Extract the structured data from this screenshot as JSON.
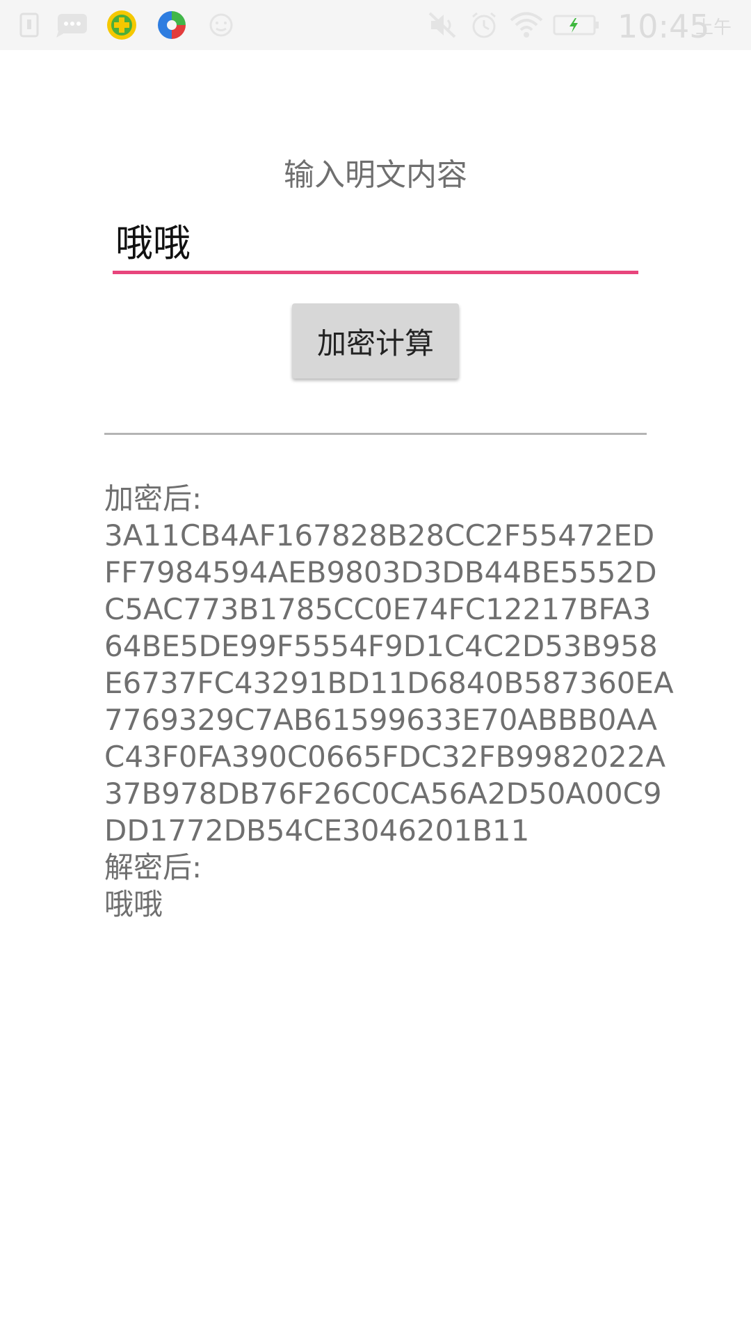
{
  "status_bar": {
    "time": "10:45",
    "ampm": "上午",
    "left_icons": [
      "sim-card-icon",
      "message-icon",
      "security-app-icon",
      "browser-app-icon",
      "face-icon"
    ],
    "right_icons": [
      "mute-icon",
      "alarm-icon",
      "wifi-icon",
      "battery-charging-icon"
    ],
    "colors": {
      "charging": "#3fb83f",
      "security_app": "#f5c800",
      "browser_blue": "#2e7de0",
      "browser_red": "#e23c3c",
      "browser_green": "#41b649"
    }
  },
  "form": {
    "prompt": "输入明文内容",
    "input_value": "哦哦",
    "button_label": "加密计算",
    "accent_color": "#e8457c"
  },
  "result": {
    "encrypted_label": "加密后:",
    "encrypted_lines": [
      "3A11CB4AF167828B28CC2F55472ED",
      "FF7984594AEB9803D3DB44BE5552D",
      "C5AC773B1785CC0E74FC12217BFA3",
      "64BE5DE99F5554F9D1C4C2D53B958",
      "E6737FC43291BD11D6840B587360EA",
      "7769329C7AB61599633E70ABBB0AA",
      "C43F0FA390C0665FDC32FB9982022A",
      "37B978DB76F26C0CA56A2D50A00C9",
      "DD1772DB54CE3046201B11"
    ],
    "decrypted_label": "解密后:",
    "decrypted_value": "哦哦"
  }
}
